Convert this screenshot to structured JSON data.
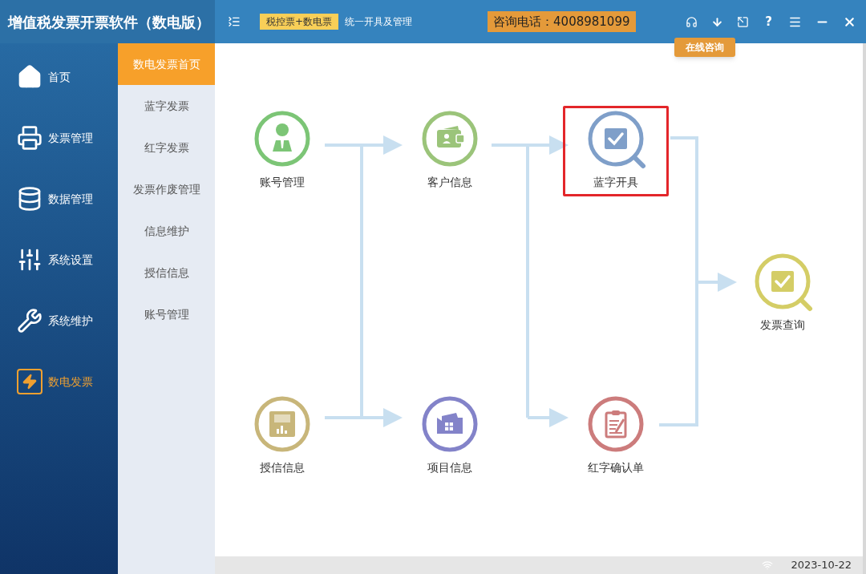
{
  "window": {
    "title": "增值税发票开票软件（数电版）"
  },
  "header": {
    "badge": "税控票+数电票",
    "subtitle": "统一开具及管理",
    "hotline": "咨询电话：4008981099",
    "help": "?",
    "tooltip": "在线咨询"
  },
  "sidebar": {
    "items": [
      {
        "label": "首页",
        "kind": "home",
        "selected": false
      },
      {
        "label": "发票管理",
        "kind": "printer",
        "selected": false
      },
      {
        "label": "数据管理",
        "kind": "data",
        "selected": false
      },
      {
        "label": "系统设置",
        "kind": "settings",
        "selected": false
      },
      {
        "label": "系统维护",
        "kind": "tools",
        "selected": false
      },
      {
        "label": "数电发票",
        "kind": "einvoice",
        "selected": true
      }
    ]
  },
  "submenu": {
    "items": [
      {
        "label": "数电发票首页",
        "selected": true
      },
      {
        "label": "蓝字发票",
        "selected": false
      },
      {
        "label": "红字发票",
        "selected": false
      },
      {
        "label": "发票作废管理",
        "selected": false
      },
      {
        "label": "信息维护",
        "selected": false
      },
      {
        "label": "授信信息",
        "selected": false
      },
      {
        "label": "账号管理",
        "selected": false
      }
    ]
  },
  "flow": {
    "nodes": [
      {
        "label": "账号管理",
        "kind": "person",
        "color": "#7cc576",
        "highlighted": false
      },
      {
        "label": "客户信息",
        "kind": "wallet",
        "color": "#9bc47a",
        "highlighted": false
      },
      {
        "label": "蓝字开具",
        "kind": "search",
        "color": "#7f9fc9",
        "highlighted": true
      },
      {
        "label": "发票查询",
        "kind": "search",
        "color": "#d4cd66",
        "highlighted": false
      },
      {
        "label": "授信信息",
        "kind": "report",
        "color": "#c8b67a",
        "highlighted": false
      },
      {
        "label": "项目信息",
        "kind": "factory",
        "color": "#8383c9",
        "highlighted": false
      },
      {
        "label": "红字确认单",
        "kind": "clipboard",
        "color": "#cc7c7c",
        "highlighted": false
      }
    ]
  },
  "status_bar": {
    "date": "2023-10-22"
  }
}
